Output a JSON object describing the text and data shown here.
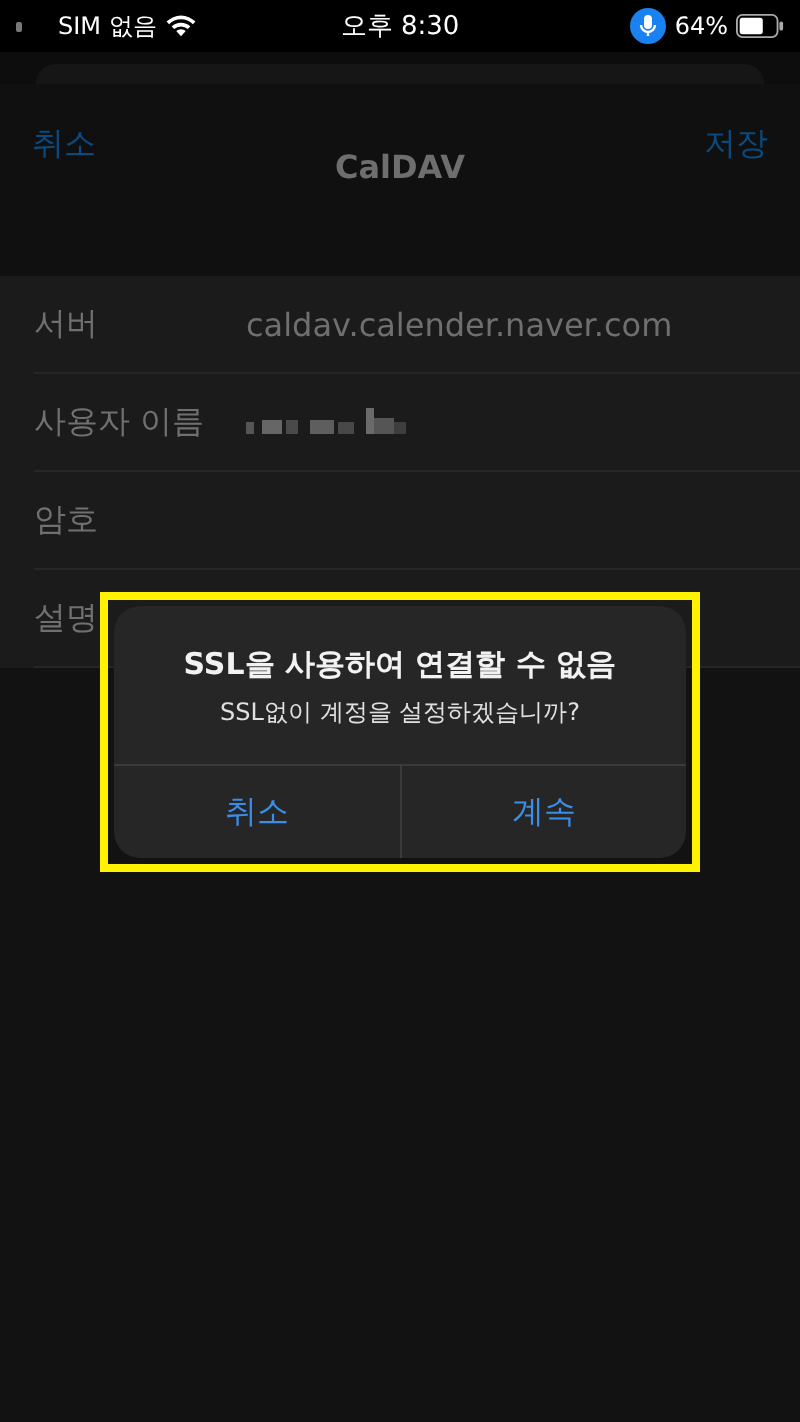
{
  "status_bar": {
    "carrier": "SIM 없음",
    "time": "오후 8:30",
    "battery": "64%",
    "mic_active": true
  },
  "nav": {
    "cancel": "취소",
    "title": "CalDAV",
    "save": "저장"
  },
  "fields": [
    {
      "label": "서버",
      "kind": "text",
      "value": "caldav.calender.naver.com"
    },
    {
      "label": "사용자 이름",
      "kind": "redacted"
    },
    {
      "label": "암호",
      "kind": "empty"
    },
    {
      "label": "설명",
      "kind": "empty"
    }
  ],
  "alert": {
    "title": "SSL을 사용하여 연결할 수 없음",
    "message": "SSL없이 계정을 설정하겠습니까?",
    "highlighted": true,
    "buttons": [
      "취소",
      "계속"
    ]
  }
}
